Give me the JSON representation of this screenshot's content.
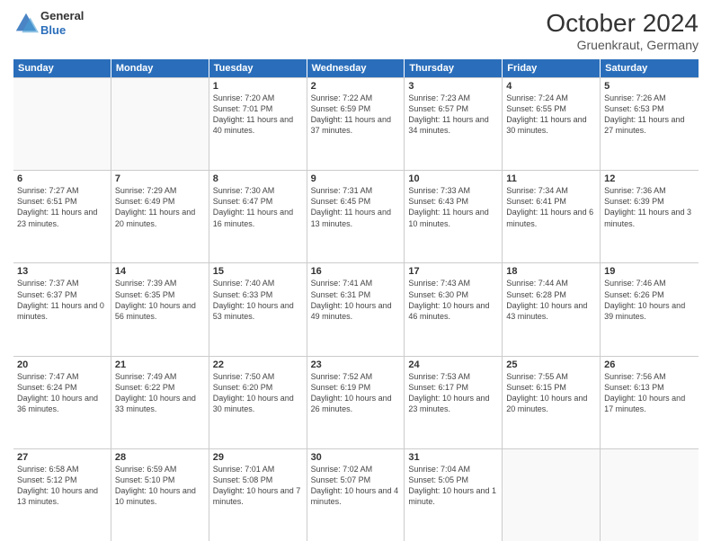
{
  "header": {
    "logo": {
      "general": "General",
      "blue": "Blue"
    },
    "month": "October 2024",
    "location": "Gruenkraut, Germany"
  },
  "weekdays": [
    "Sunday",
    "Monday",
    "Tuesday",
    "Wednesday",
    "Thursday",
    "Friday",
    "Saturday"
  ],
  "rows": [
    [
      {
        "day": "",
        "detail": "",
        "empty": true
      },
      {
        "day": "",
        "detail": "",
        "empty": true
      },
      {
        "day": "1",
        "detail": "Sunrise: 7:20 AM\nSunset: 7:01 PM\nDaylight: 11 hours and 40 minutes."
      },
      {
        "day": "2",
        "detail": "Sunrise: 7:22 AM\nSunset: 6:59 PM\nDaylight: 11 hours and 37 minutes."
      },
      {
        "day": "3",
        "detail": "Sunrise: 7:23 AM\nSunset: 6:57 PM\nDaylight: 11 hours and 34 minutes."
      },
      {
        "day": "4",
        "detail": "Sunrise: 7:24 AM\nSunset: 6:55 PM\nDaylight: 11 hours and 30 minutes."
      },
      {
        "day": "5",
        "detail": "Sunrise: 7:26 AM\nSunset: 6:53 PM\nDaylight: 11 hours and 27 minutes."
      }
    ],
    [
      {
        "day": "6",
        "detail": "Sunrise: 7:27 AM\nSunset: 6:51 PM\nDaylight: 11 hours and 23 minutes."
      },
      {
        "day": "7",
        "detail": "Sunrise: 7:29 AM\nSunset: 6:49 PM\nDaylight: 11 hours and 20 minutes."
      },
      {
        "day": "8",
        "detail": "Sunrise: 7:30 AM\nSunset: 6:47 PM\nDaylight: 11 hours and 16 minutes."
      },
      {
        "day": "9",
        "detail": "Sunrise: 7:31 AM\nSunset: 6:45 PM\nDaylight: 11 hours and 13 minutes."
      },
      {
        "day": "10",
        "detail": "Sunrise: 7:33 AM\nSunset: 6:43 PM\nDaylight: 11 hours and 10 minutes."
      },
      {
        "day": "11",
        "detail": "Sunrise: 7:34 AM\nSunset: 6:41 PM\nDaylight: 11 hours and 6 minutes."
      },
      {
        "day": "12",
        "detail": "Sunrise: 7:36 AM\nSunset: 6:39 PM\nDaylight: 11 hours and 3 minutes."
      }
    ],
    [
      {
        "day": "13",
        "detail": "Sunrise: 7:37 AM\nSunset: 6:37 PM\nDaylight: 11 hours and 0 minutes."
      },
      {
        "day": "14",
        "detail": "Sunrise: 7:39 AM\nSunset: 6:35 PM\nDaylight: 10 hours and 56 minutes."
      },
      {
        "day": "15",
        "detail": "Sunrise: 7:40 AM\nSunset: 6:33 PM\nDaylight: 10 hours and 53 minutes."
      },
      {
        "day": "16",
        "detail": "Sunrise: 7:41 AM\nSunset: 6:31 PM\nDaylight: 10 hours and 49 minutes."
      },
      {
        "day": "17",
        "detail": "Sunrise: 7:43 AM\nSunset: 6:30 PM\nDaylight: 10 hours and 46 minutes."
      },
      {
        "day": "18",
        "detail": "Sunrise: 7:44 AM\nSunset: 6:28 PM\nDaylight: 10 hours and 43 minutes."
      },
      {
        "day": "19",
        "detail": "Sunrise: 7:46 AM\nSunset: 6:26 PM\nDaylight: 10 hours and 39 minutes."
      }
    ],
    [
      {
        "day": "20",
        "detail": "Sunrise: 7:47 AM\nSunset: 6:24 PM\nDaylight: 10 hours and 36 minutes."
      },
      {
        "day": "21",
        "detail": "Sunrise: 7:49 AM\nSunset: 6:22 PM\nDaylight: 10 hours and 33 minutes."
      },
      {
        "day": "22",
        "detail": "Sunrise: 7:50 AM\nSunset: 6:20 PM\nDaylight: 10 hours and 30 minutes."
      },
      {
        "day": "23",
        "detail": "Sunrise: 7:52 AM\nSunset: 6:19 PM\nDaylight: 10 hours and 26 minutes."
      },
      {
        "day": "24",
        "detail": "Sunrise: 7:53 AM\nSunset: 6:17 PM\nDaylight: 10 hours and 23 minutes."
      },
      {
        "day": "25",
        "detail": "Sunrise: 7:55 AM\nSunset: 6:15 PM\nDaylight: 10 hours and 20 minutes."
      },
      {
        "day": "26",
        "detail": "Sunrise: 7:56 AM\nSunset: 6:13 PM\nDaylight: 10 hours and 17 minutes."
      }
    ],
    [
      {
        "day": "27",
        "detail": "Sunrise: 6:58 AM\nSunset: 5:12 PM\nDaylight: 10 hours and 13 minutes."
      },
      {
        "day": "28",
        "detail": "Sunrise: 6:59 AM\nSunset: 5:10 PM\nDaylight: 10 hours and 10 minutes."
      },
      {
        "day": "29",
        "detail": "Sunrise: 7:01 AM\nSunset: 5:08 PM\nDaylight: 10 hours and 7 minutes."
      },
      {
        "day": "30",
        "detail": "Sunrise: 7:02 AM\nSunset: 5:07 PM\nDaylight: 10 hours and 4 minutes."
      },
      {
        "day": "31",
        "detail": "Sunrise: 7:04 AM\nSunset: 5:05 PM\nDaylight: 10 hours and 1 minute."
      },
      {
        "day": "",
        "detail": "",
        "empty": true
      },
      {
        "day": "",
        "detail": "",
        "empty": true
      }
    ]
  ]
}
